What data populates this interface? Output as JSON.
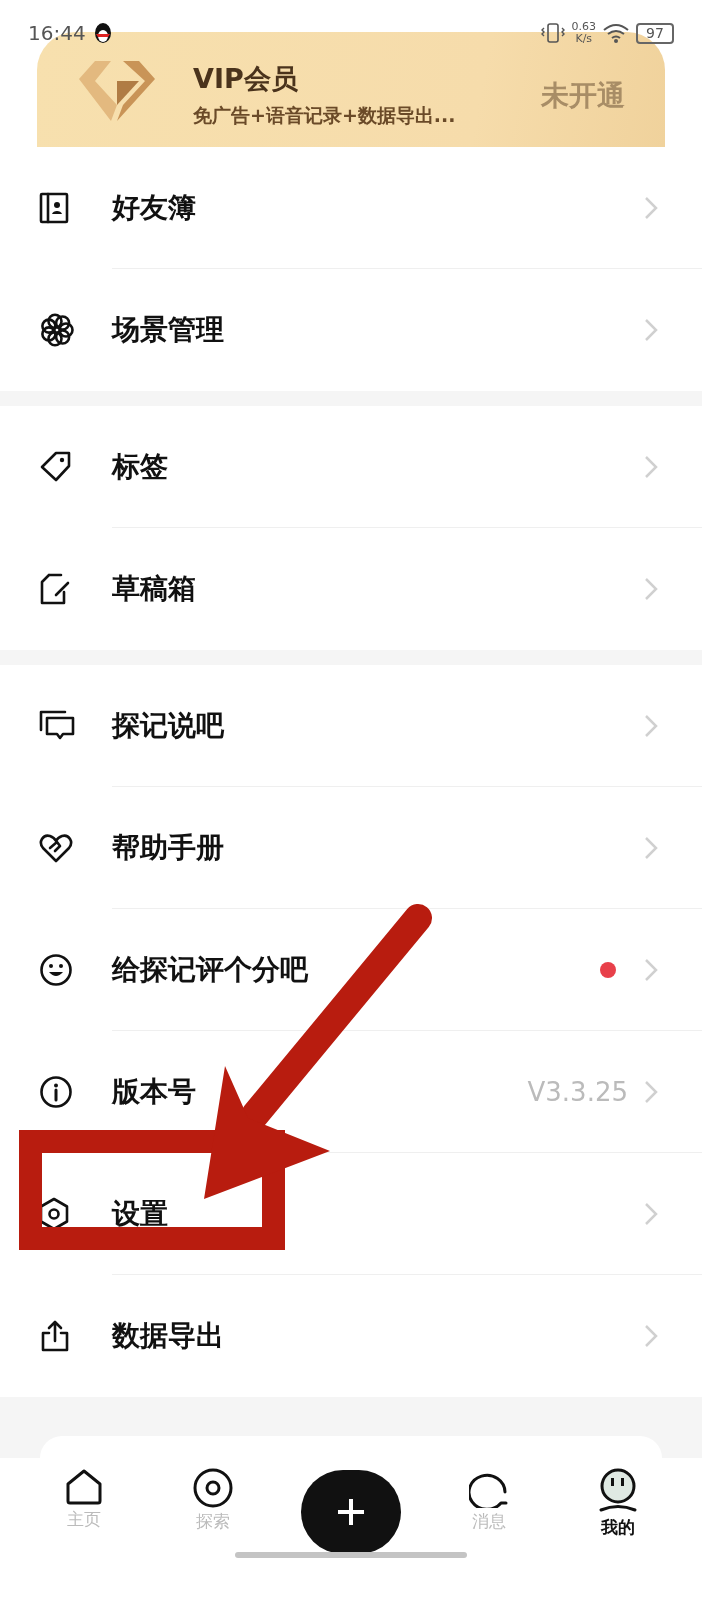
{
  "status_bar": {
    "time": "16:44",
    "net_speed": "0.63",
    "net_unit": "K/s",
    "battery": "97"
  },
  "vip_card": {
    "title": "VIP会员",
    "subtitle": "免广告+语音记录+数据导出...",
    "status": "未开通"
  },
  "menu_groups": [
    {
      "items": [
        {
          "label": "好友簿",
          "badge_dot": false,
          "highlighted": false
        },
        {
          "label": "场景管理",
          "badge_dot": false,
          "highlighted": false
        }
      ]
    },
    {
      "items": [
        {
          "label": "标签",
          "badge_dot": false,
          "highlighted": false
        },
        {
          "label": "草稿箱",
          "badge_dot": false,
          "highlighted": false
        }
      ]
    },
    {
      "items": [
        {
          "label": "探记说吧",
          "badge_dot": false,
          "highlighted": false
        },
        {
          "label": "帮助手册",
          "badge_dot": false,
          "highlighted": false
        },
        {
          "label": "给探记评个分吧",
          "badge_dot": true,
          "highlighted": false
        },
        {
          "label": "版本号",
          "value": "V3.3.25",
          "badge_dot": false,
          "highlighted": false
        },
        {
          "label": "设置",
          "badge_dot": false,
          "highlighted": true
        },
        {
          "label": "数据导出",
          "badge_dot": false,
          "highlighted": false
        }
      ]
    }
  ],
  "tab_bar": {
    "items": [
      {
        "kind": "tab",
        "label": "主页",
        "selected": false
      },
      {
        "kind": "tab",
        "label": "探索",
        "selected": false
      },
      {
        "kind": "add"
      },
      {
        "kind": "tab",
        "label": "消息",
        "selected": false
      },
      {
        "kind": "tab",
        "label": "我的",
        "selected": true
      }
    ]
  }
}
